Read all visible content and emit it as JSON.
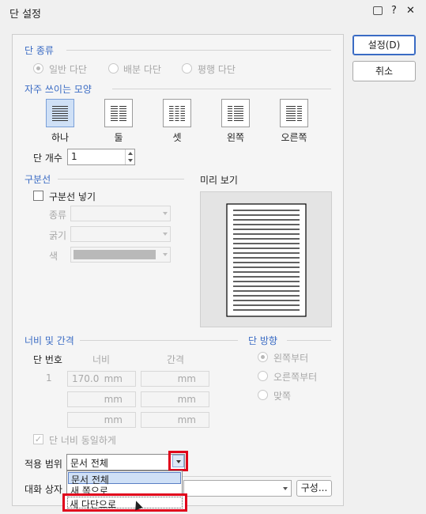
{
  "window": {
    "title": "단 설정",
    "close_glyph": "✕",
    "help_glyph": "?"
  },
  "buttons": {
    "ok": "설정(D)",
    "cancel": "취소",
    "config": "구성..."
  },
  "col_type": {
    "label": "단 종류",
    "options": [
      {
        "label": "일반 다단",
        "selected": true
      },
      {
        "label": "배분 다단",
        "selected": false
      },
      {
        "label": "평행 다단",
        "selected": false
      }
    ]
  },
  "presets": {
    "label": "자주 쓰이는 모양",
    "items": [
      {
        "label": "하나",
        "icon": "one-column-icon",
        "selected": true
      },
      {
        "label": "둘",
        "icon": "two-columns-icon",
        "selected": false
      },
      {
        "label": "셋",
        "icon": "three-columns-icon",
        "selected": false
      },
      {
        "label": "왼쪽",
        "icon": "left-column-icon",
        "selected": false
      },
      {
        "label": "오른쪽",
        "icon": "right-column-icon",
        "selected": false
      }
    ]
  },
  "col_count": {
    "label": "단 개수",
    "value": "1"
  },
  "divider": {
    "label": "구분선",
    "checkbox": "구분선 넣기",
    "type_label": "종류",
    "width_label": "굵기",
    "color_label": "색"
  },
  "preview": {
    "label": "미리 보기"
  },
  "spacing": {
    "label": "너비 및 간격",
    "col_no_label": "단 번호",
    "width_label": "너비",
    "gap_label": "간격",
    "rows": [
      {
        "no": "1",
        "width": "170.0",
        "gap": ""
      },
      {
        "no": "",
        "width": "",
        "gap": ""
      },
      {
        "no": "",
        "width": "",
        "gap": ""
      }
    ],
    "unit": "mm",
    "equal_width": "단 너비 동일하게"
  },
  "direction": {
    "label": "단 방향",
    "options": [
      {
        "label": "왼쪽부터",
        "selected": true
      },
      {
        "label": "오른쪽부터",
        "selected": false
      },
      {
        "label": "맞쪽",
        "selected": false
      }
    ]
  },
  "apply": {
    "label": "적용 범위",
    "value": "문서 전체",
    "dropdown_options": [
      "문서 전체",
      "새 쪽으로",
      "새 다단으로"
    ]
  },
  "dialog_row": {
    "label": "대화 상자"
  },
  "colors": {
    "accent": "#3a6bc4",
    "highlight": "#e0001b",
    "selection": "#cfe0f6"
  }
}
